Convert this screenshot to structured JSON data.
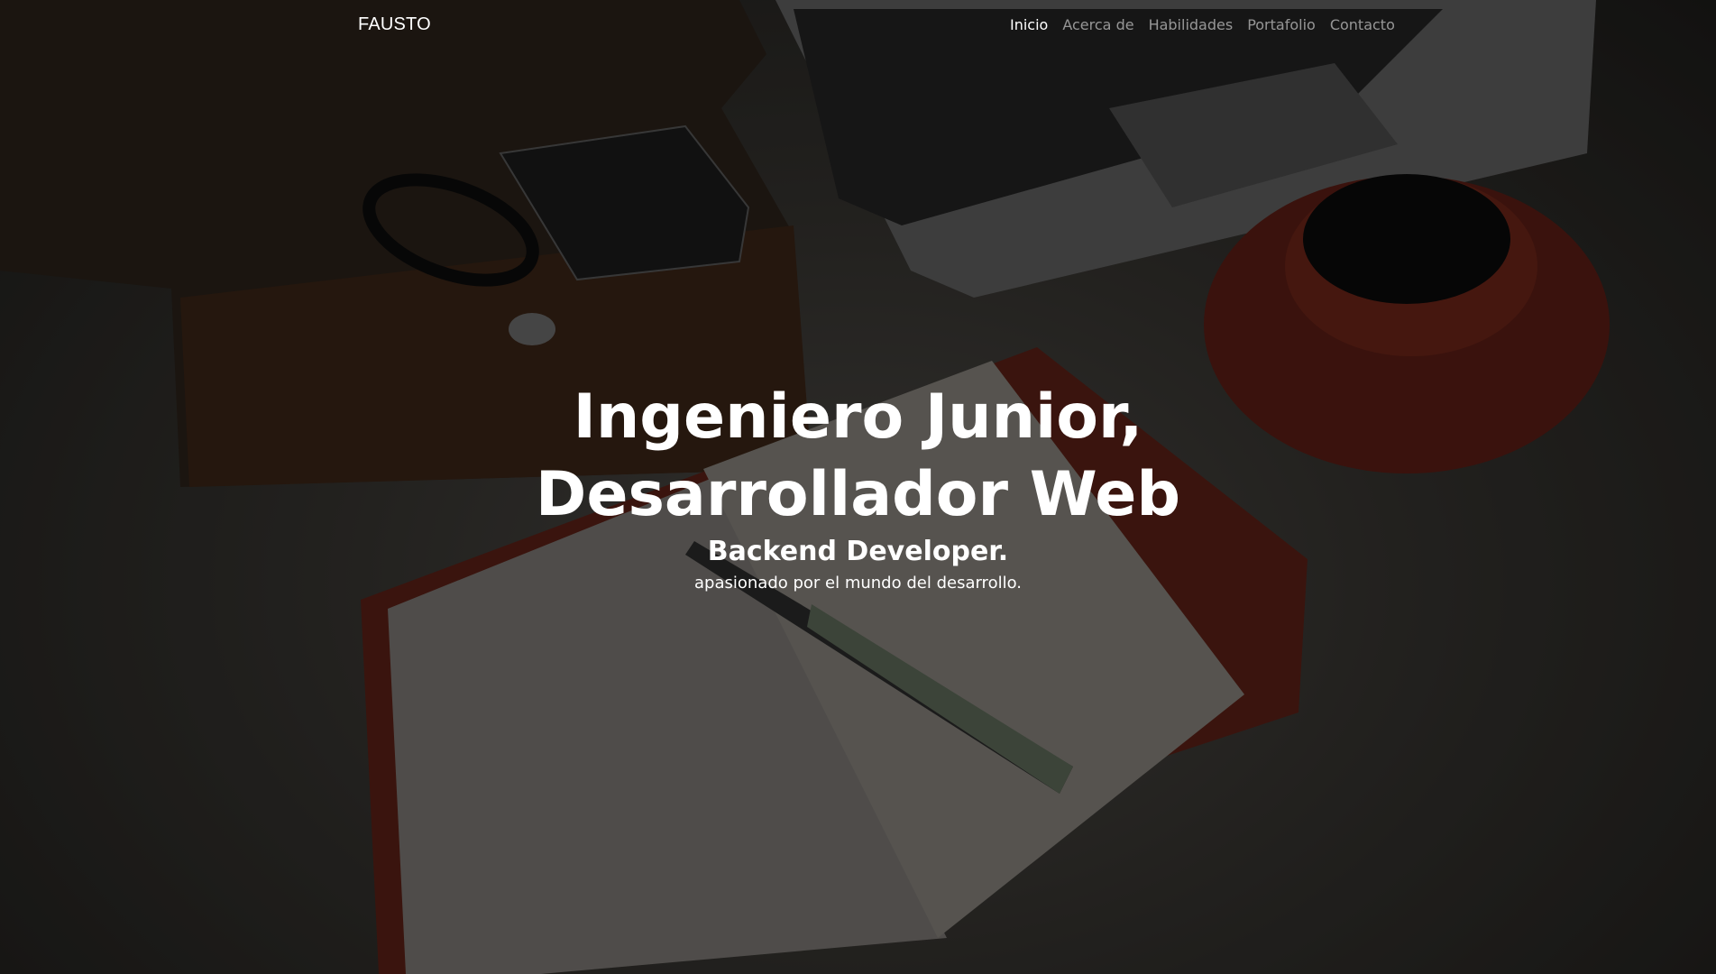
{
  "navbar": {
    "brand": "FAUSTO",
    "links": [
      {
        "label": "Inicio",
        "active": true
      },
      {
        "label": "Acerca de",
        "active": false
      },
      {
        "label": "Habilidades",
        "active": false
      },
      {
        "label": "Portafolio",
        "active": false
      },
      {
        "label": "Contacto",
        "active": false
      }
    ]
  },
  "hero": {
    "title": "Ingeniero Junior, Desarrollador Web",
    "subtitle": "Backend Developer.",
    "description": "apasionado por el mundo del desarrollo."
  },
  "colors": {
    "accent_red": "#9b2a1c",
    "nav_inactive": "rgba(255,255,255,0.55)",
    "text": "#ffffff"
  }
}
